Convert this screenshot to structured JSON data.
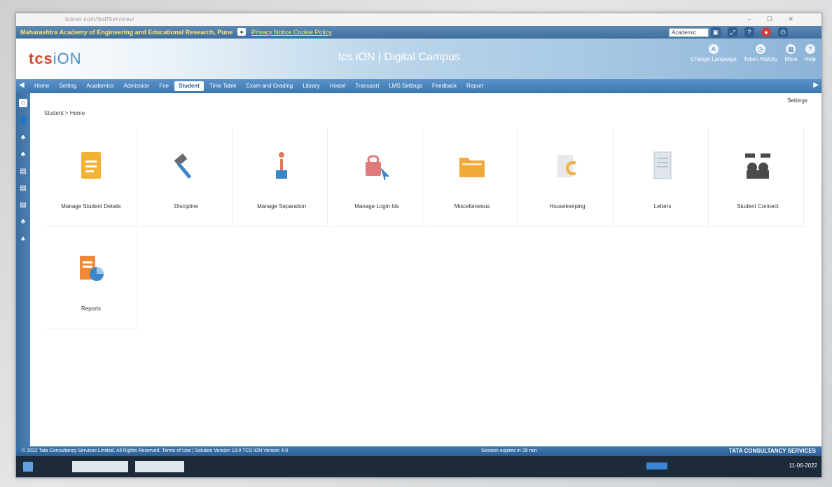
{
  "browser": {
    "address": "tcsion.com/SelfServices/",
    "window_controls": "– ☐ ✕"
  },
  "topbar": {
    "institute": "Maharashtra Academy of Engineering and Educational Research, Pune",
    "links": "Privacy Notice Cookie Policy",
    "academic_select": "Academic",
    "icons": [
      "photo-icon",
      "expand-icon",
      "help-icon",
      "notification-icon",
      "power-icon"
    ]
  },
  "header": {
    "logo_tcs": "tcs",
    "logo_ion": "iON",
    "product_title": "tcs iON | Digital Campus",
    "actions": [
      {
        "label": "Change Language",
        "icon": "language-icon"
      },
      {
        "label": "Token History",
        "icon": "clock-icon"
      },
      {
        "label": "More",
        "icon": "grid-icon"
      },
      {
        "label": "Help",
        "icon": "help-icon"
      }
    ]
  },
  "nav": {
    "items": [
      "Home",
      "Setting",
      "Academics",
      "Admission",
      "Fee",
      "Student",
      "Time Table",
      "Exam and Grading",
      "Library",
      "Hostel",
      "Transport",
      "LMS Settings",
      "Feedback",
      "Report"
    ],
    "active": "Student"
  },
  "breadcrumb": "Student > Home",
  "settings_link": "Settings",
  "tiles": [
    {
      "label": "Manage Student Details",
      "icon": "document-icon",
      "color": "#f2b233"
    },
    {
      "label": "Discipline",
      "icon": "gavel-icon",
      "color": "#6a6a6a"
    },
    {
      "label": "Manage Separation",
      "icon": "separation-icon",
      "color": "#3a86c8"
    },
    {
      "label": "Manage Login Ids",
      "icon": "login-icon",
      "color": "#e07a7a"
    },
    {
      "label": "Miscellaneous",
      "icon": "folder-icon",
      "color": "#f3a93a"
    },
    {
      "label": "Housekeeping",
      "icon": "housekeeping-icon",
      "color": "#f0b040"
    },
    {
      "label": "Letters",
      "icon": "letter-icon",
      "color": "#b8c4cf"
    },
    {
      "label": "Student Connect",
      "icon": "connect-icon",
      "color": "#4a4a4a"
    },
    {
      "label": "Reports",
      "icon": "report-icon",
      "color": "#f08a3a"
    }
  ],
  "footer": {
    "copyright": "© 2022 Tata Consultancy Services Limited. All Rights Reserved.  Terms of Use | Solution Version 13.0  TCS iON Version 4.0",
    "session": "Session expires in 29 min",
    "brand": "TATA CONSULTANCY SERVICES"
  },
  "taskbar": {
    "clock": "11-06-2022"
  }
}
